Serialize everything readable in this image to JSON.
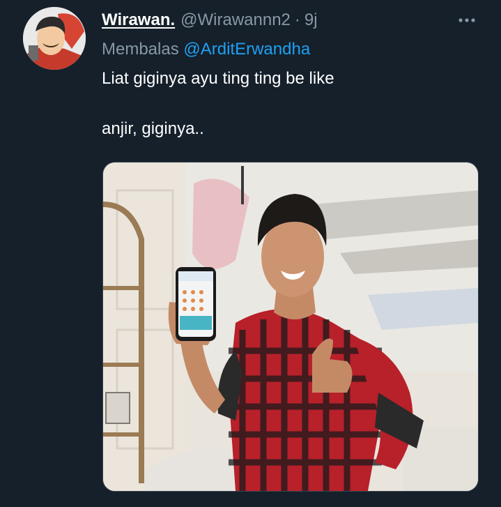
{
  "tweet": {
    "display_name": "Wirawan.",
    "handle": "@Wirawannn2",
    "separator": "·",
    "time": "9j",
    "reply_prefix": "Membalas",
    "reply_to": "@ArditErwandha",
    "text_lines": [
      "Liat giginya ayu ting ting be like",
      "anjir, giginya.."
    ]
  },
  "icons": {
    "more": "more-horizontal-icon",
    "avatar": "avatar-cartoon"
  },
  "colors": {
    "background": "#15202b",
    "secondary_text": "#8899a6",
    "accent": "#1da1f2",
    "primary_text": "#ffffff"
  }
}
